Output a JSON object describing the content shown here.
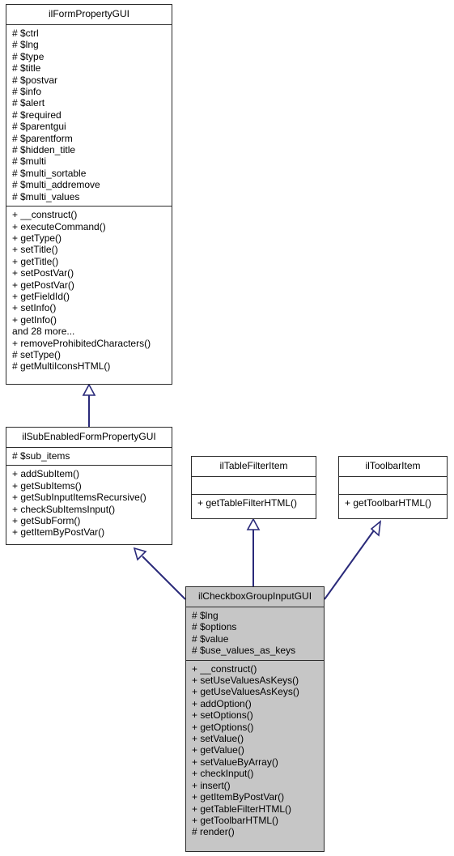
{
  "diagram": {
    "type": "uml-class-inheritance",
    "background_color": "#ffffff",
    "edge_color": "#2a2a7a",
    "node_border_color": "#2b2b2b",
    "highlight_fill": "#c6c6c6"
  },
  "nodes": {
    "form_property_gui": {
      "name": "ilFormPropertyGUI",
      "attributes": [
        "# $ctrl",
        "# $lng",
        "# $type",
        "# $title",
        "# $postvar",
        "# $info",
        "# $alert",
        "# $required",
        "# $parentgui",
        "# $parentform",
        "# $hidden_title",
        "# $multi",
        "# $multi_sortable",
        "# $multi_addremove",
        "# $multi_values"
      ],
      "methods": [
        "+ __construct()",
        "+ executeCommand()",
        "+ getType()",
        "+ setTitle()",
        "+ getTitle()",
        "+ setPostVar()",
        "+ getPostVar()",
        "+ getFieldId()",
        "+ setInfo()",
        "+ getInfo()",
        "and 28 more...",
        "+ removeProhibitedCharacters()",
        "# setType()",
        "# getMultiIconsHTML()"
      ]
    },
    "sub_enabled_form_property_gui": {
      "name": "ilSubEnabledFormPropertyGUI",
      "attributes": [
        "# $sub_items"
      ],
      "methods": [
        "+ addSubItem()",
        "+ getSubItems()",
        "+ getSubInputItemsRecursive()",
        "+ checkSubItemsInput()",
        "+ getSubForm()",
        "+ getItemByPostVar()"
      ]
    },
    "table_filter_item": {
      "name": "ilTableFilterItem",
      "attributes": [],
      "methods": [
        "+ getTableFilterHTML()"
      ]
    },
    "toolbar_item": {
      "name": "ilToolbarItem",
      "attributes": [],
      "methods": [
        "+ getToolbarHTML()"
      ]
    },
    "checkbox_group_input_gui": {
      "name": "ilCheckboxGroupInputGUI",
      "attributes": [
        "# $lng",
        "# $options",
        "# $value",
        "# $use_values_as_keys"
      ],
      "methods": [
        "+ __construct()",
        "+ setUseValuesAsKeys()",
        "+ getUseValuesAsKeys()",
        "+ addOption()",
        "+ setOptions()",
        "+ getOptions()",
        "+ setValue()",
        "+ getValue()",
        "+ setValueByArray()",
        "+ checkInput()",
        "+ insert()",
        "+ getItemByPostVar()",
        "+ getTableFilterHTML()",
        "+ getToolbarHTML()",
        "# render()"
      ]
    }
  },
  "edges": [
    {
      "from": "sub_enabled_form_property_gui",
      "to": "form_property_gui",
      "kind": "generalization"
    },
    {
      "from": "checkbox_group_input_gui",
      "to": "sub_enabled_form_property_gui",
      "kind": "generalization"
    },
    {
      "from": "checkbox_group_input_gui",
      "to": "table_filter_item",
      "kind": "generalization"
    },
    {
      "from": "checkbox_group_input_gui",
      "to": "toolbar_item",
      "kind": "generalization"
    }
  ]
}
